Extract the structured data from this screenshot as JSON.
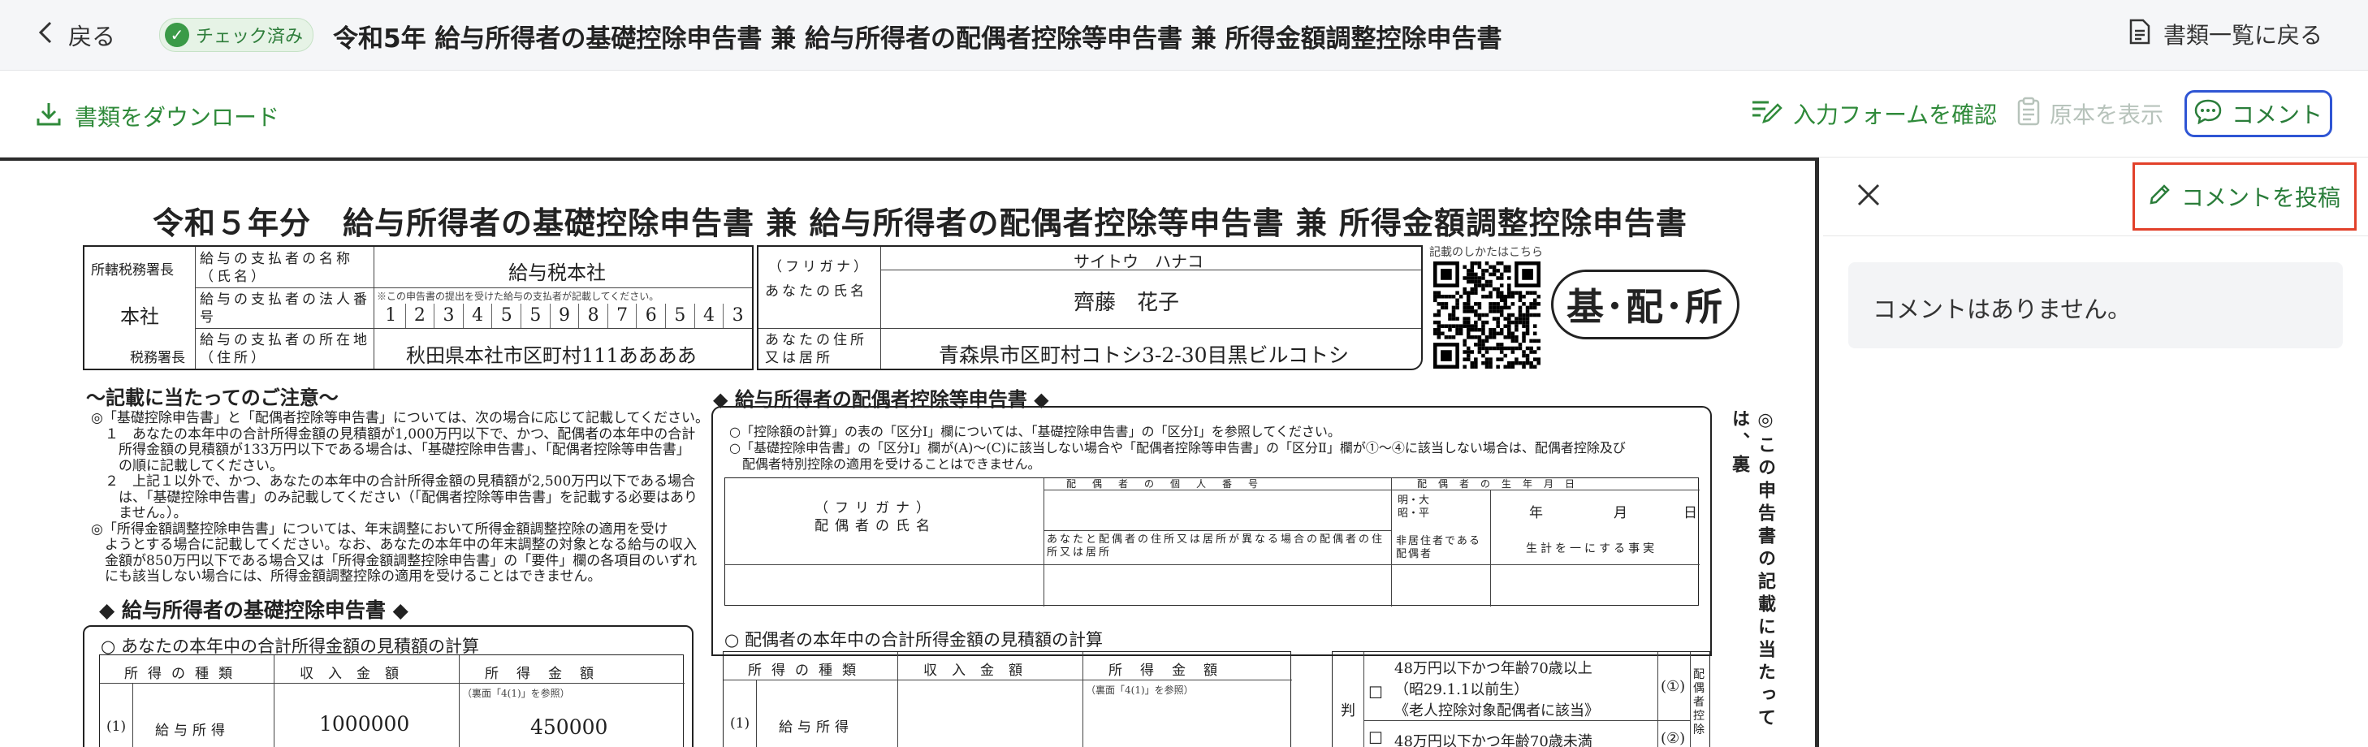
{
  "topbar": {
    "back_label": "戻る",
    "status_chip": "チェック済み",
    "title": "令和5年 給与所得者の基礎控除申告書 兼 給与所得者の配偶者控除等申告書 兼 所得金額調整控除申告書",
    "doc_list_label": "書類一覧に戻る"
  },
  "toolbar": {
    "download_label": "書類をダウンロード",
    "confirm_form_label": "入力フォームを確認",
    "show_original_label": "原本を表示",
    "comment_label": "コメント"
  },
  "sidebar": {
    "post_comment_label": "コメントを投稿",
    "empty_message": "コメントはありません。"
  },
  "colors": {
    "accent_green": "#2f8a3a",
    "focus_blue": "#2f55d4",
    "highlight_red": "#e2402a"
  },
  "document": {
    "title": "令和５年分　給与所得者の基礎控除申告書 兼 給与所得者の配偶者控除等申告書 兼 所得金額調整控除申告書",
    "tax_office_label": "所轄税務署長",
    "tax_office": "本社",
    "tax_office_suffix": "税務署長",
    "payer_name_label": "給与の支払者の名称（氏名）",
    "payer_name": "給与税本社",
    "payer_number_label": "給与の支払者の法人番号",
    "payer_number_note": "※この申告書の提出を受けた給与の支払者が記載してください。",
    "payer_number_digits": [
      "1",
      "2",
      "3",
      "4",
      "5",
      "5",
      "9",
      "8",
      "7",
      "6",
      "5",
      "4",
      "3"
    ],
    "payer_address_label": "給与の支払者の所在地（住所）",
    "payer_address": "秋田県本社市区町村111ああああ",
    "furigana_label": "（フリガナ）",
    "name_label": "あなたの氏名",
    "furigana": "サイトウ　ハナコ",
    "name": "齊藤　花子",
    "address_label": "あなたの住所又は居所",
    "address": "青森県市区町村コトシ3-2-30目黒ビルコトシ",
    "qr_caption": "記載のしかたはこちら",
    "stamp": "基･配･所",
    "notes_title": "〜記載に当たってのご注意〜",
    "notes": [
      "◎「基礎控除申告書」と「配偶者控除等申告書」については、次の場合に応じて記載してください。",
      "　１　あなたの本年中の合計所得金額の見積額が1,000万円以下で、かつ、配偶者の本年中の合計",
      "　　所得金額の見積額が133万円以下である場合は、「基礎控除申告書」、「配偶者控除等申告書」",
      "　　の順に記載してください。",
      "　２　上記１以外で、かつ、あなたの本年中の合計所得金額の見積額が2,500万円以下である場合",
      "　　は、「基礎控除申告書」のみ記載してください（「配偶者控除等申告書」を記載する必要はあり",
      "　　ません。）。",
      "◎「所得金額調整控除申告書」については、年末調整において所得金額調整控除の適用を受け",
      "　ようとする場合に記載してください。なお、あなたの本年中の年末調整の対象となる給与の収入",
      "　金額が850万円以下である場合又は「所得金額調整控除申告書」の「要件」欄の各項目のいずれ",
      "　にも該当しない場合には、所得金額調整控除の適用を受けることはできません。"
    ],
    "basic_section_title": "◆ 給与所得者の基礎控除申告書 ◆",
    "basic_calc_title": "○ あなたの本年中の合計所得金額の見積額の計算",
    "income_type_header": "所得の種類",
    "income_amount_header": "収入金額",
    "income_header": "所得金額",
    "ura_note": "（裏面「4(1)」を参照）",
    "row_num": "(1)",
    "salary_label": "給与所得",
    "salary_amount": "1000000",
    "salary_income": "450000",
    "spouse_section_title": "◆ 給与所得者の配偶者控除等申告書 ◆",
    "spouse_notes": [
      "○「控除額の計算」の表の「区分Ⅰ」欄については、「基礎控除申告書」の「区分Ⅰ」を参照してください。",
      "○「基礎控除申告書」の「区分Ⅰ」欄が(A)〜(C)に該当しない場合や「配偶者控除等申告書」の「区分Ⅱ」欄が①〜④に該当しない場合は、配偶者控除及び",
      "　配偶者特別控除の適用を受けることはできません。"
    ],
    "spouse_furigana_label": "（フリガナ）",
    "spouse_name_label": "配偶者の氏名",
    "spouse_number_label": "配偶者の個人番号",
    "spouse_address_label": "あなたと配偶者の住所又は居所が異なる場合の配偶者の住所又は居所",
    "spouse_birth_label": "配偶者の生年月日",
    "era_label": "明・大\n昭・平",
    "ymd": [
      "年",
      "月",
      "日"
    ],
    "nonresident_label": "非居住者である配偶者",
    "same_living_label": "生計を一にする事実",
    "spouse_calc_title": "○ 配偶者の本年中の合計所得金額の見積額の計算",
    "judge_label": "判",
    "choice1_line1": "48万円以下かつ年齢70歳以上",
    "choice1_line2": "（昭29.1.1以前生）",
    "choice1_line3": "《老人控除対象配偶者に該当》",
    "choice1_mark": "(①)",
    "choice2_line1": "48万円以下かつ年齢70歳未満",
    "choice2_mark": "(②)",
    "deduction_side_label": "配偶者控除",
    "vertical_note": "◎この申告書の記載に当たっては、裏"
  }
}
